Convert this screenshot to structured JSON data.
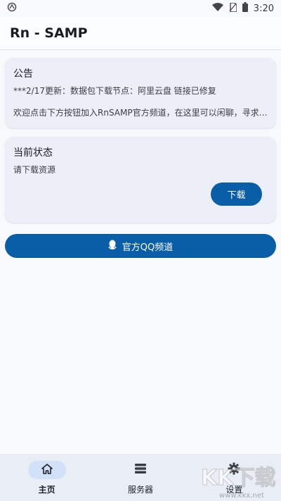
{
  "status_bar": {
    "time": "3:20"
  },
  "app_bar": {
    "title": "Rn - SAMP"
  },
  "notice_card": {
    "title": "公告",
    "line1": "***2/17更新：数据包下载节点：阿里云盘 链接已修复",
    "line2": "欢迎点击下方按钮加入RnSAMP官方频道，在这里可以闲聊，寻求帮..."
  },
  "status_card": {
    "title": "当前状态",
    "message": "请下载资源",
    "download_label": "下载"
  },
  "qq_button": {
    "label": "官方QQ频道"
  },
  "bottom_nav": {
    "items": [
      {
        "label": "主页",
        "icon": "home-icon",
        "active": true
      },
      {
        "label": "服务器",
        "icon": "server-list-icon",
        "active": false
      },
      {
        "label": "设置",
        "icon": "gear-icon",
        "active": false
      }
    ]
  },
  "watermark": {
    "text": "KK下载",
    "url_text": "www.kkx.net"
  },
  "colors": {
    "accent": "#0a5ea8",
    "card": "#eceff7",
    "nav": "#e8edf6",
    "nav_active": "#d2e1f7"
  }
}
